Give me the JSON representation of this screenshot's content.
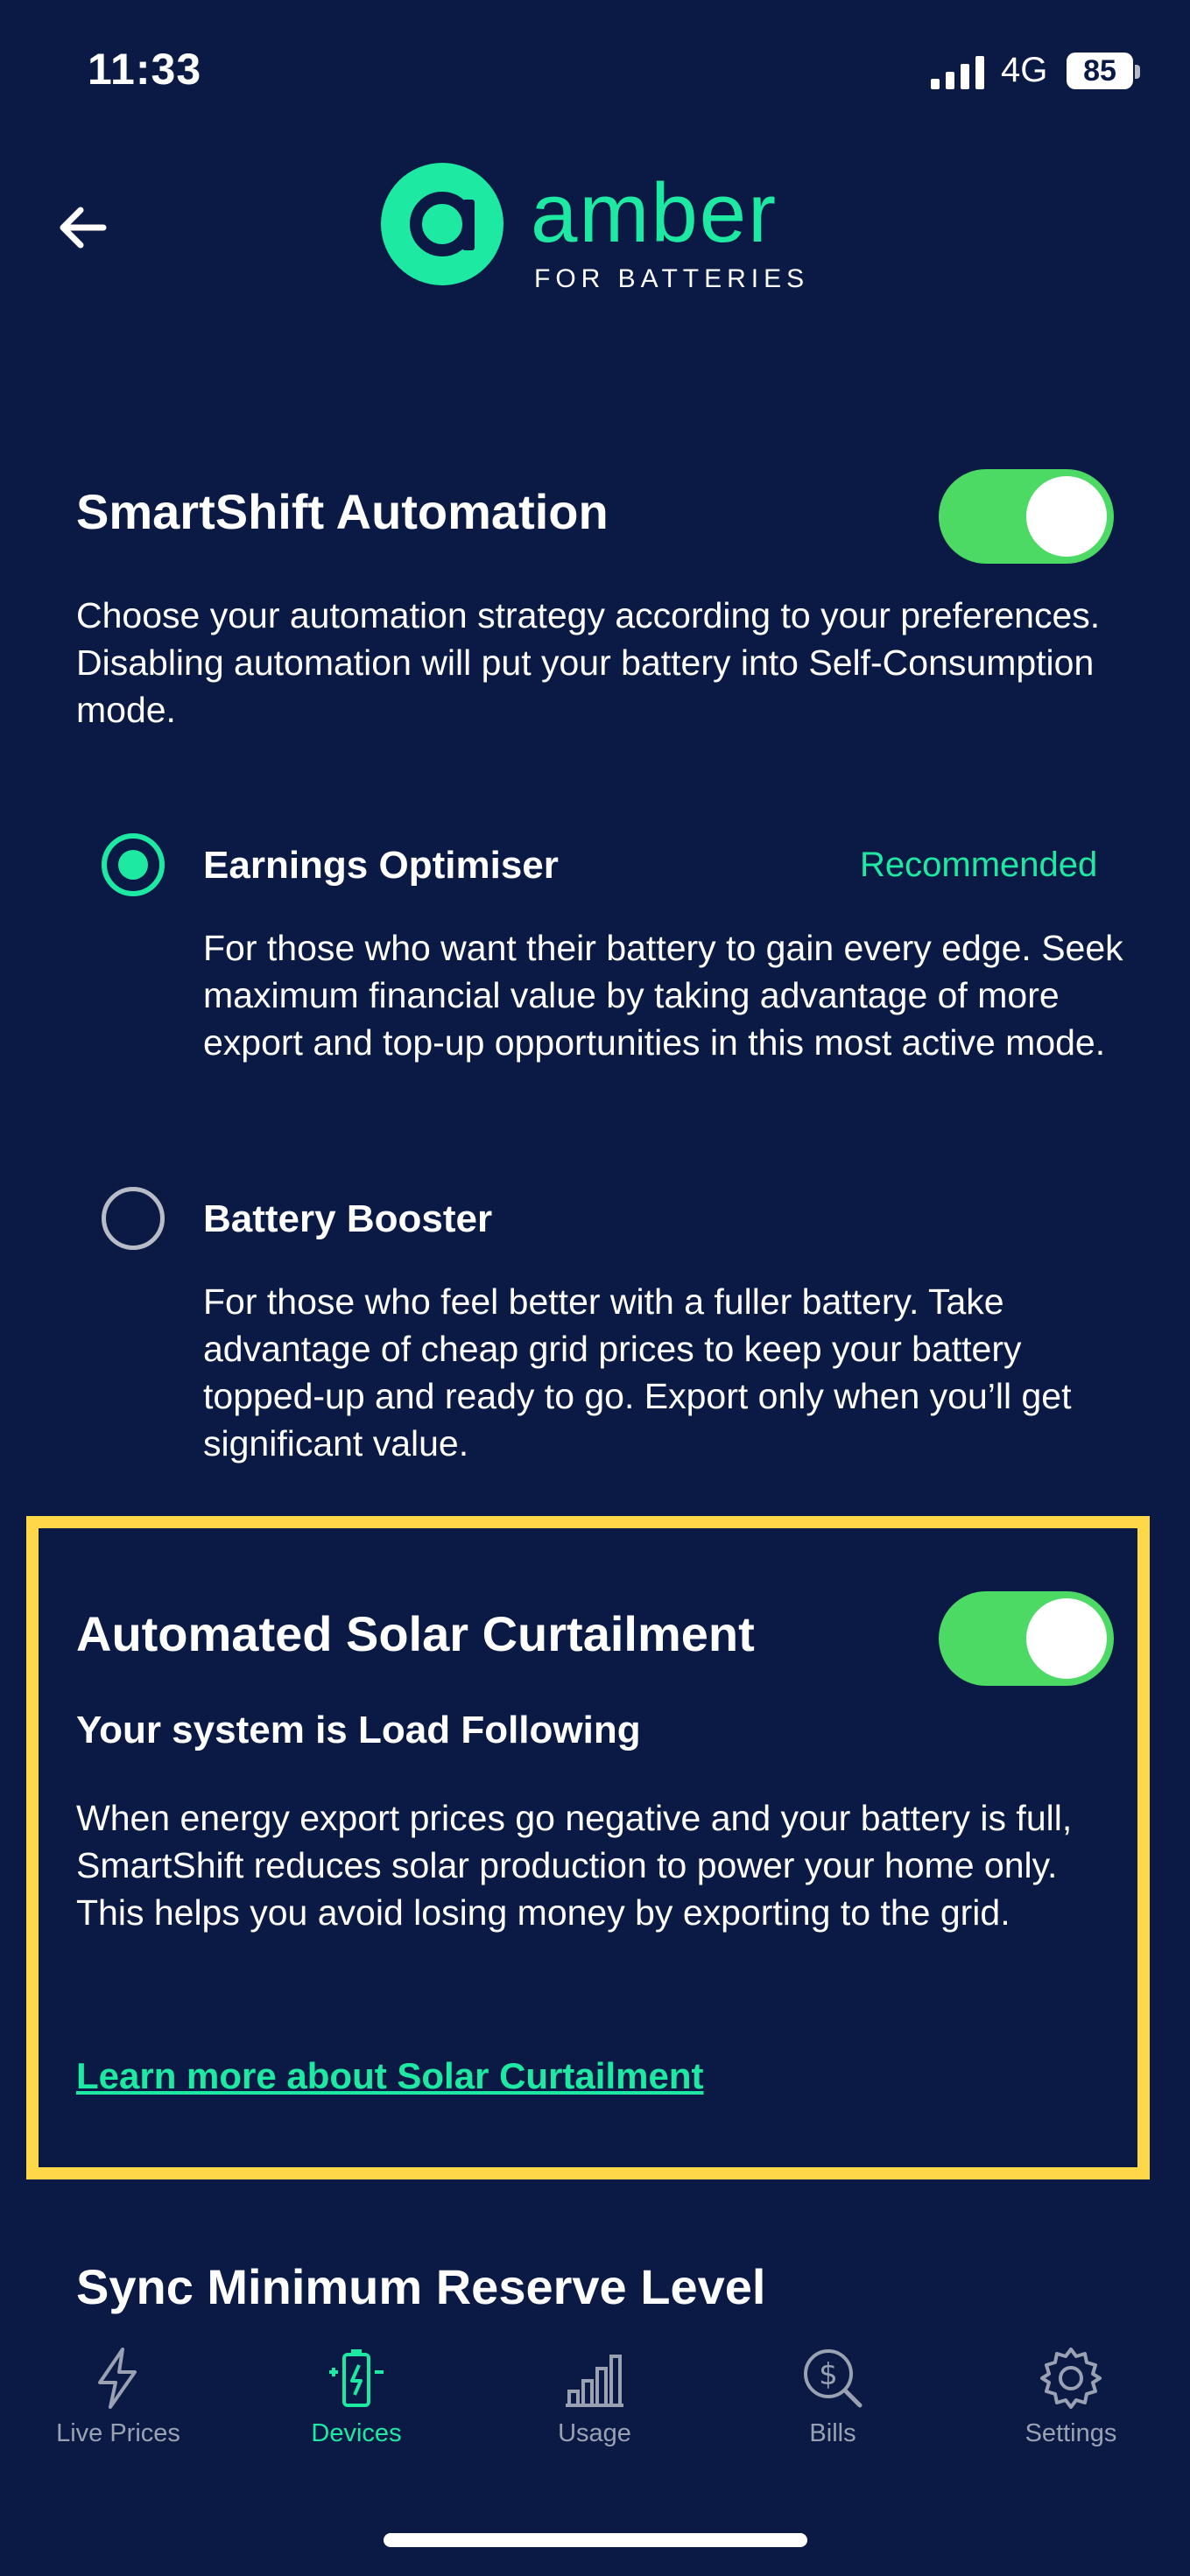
{
  "status_bar": {
    "time": "11:33",
    "network": "4G",
    "battery": "85"
  },
  "header": {
    "brand": "amber",
    "brand_sub": "FOR BATTERIES",
    "back_icon": "arrow-left-icon"
  },
  "smartshift": {
    "title": "SmartShift Automation",
    "enabled": true,
    "description": "Choose your automation strategy according to your preferences. Disabling automation will put your battery into Self-Consumption mode.",
    "options": [
      {
        "title": "Earnings Optimiser",
        "badge": "Recommended",
        "selected": true,
        "description": "For those who want their battery to gain every edge. Seek maximum financial value by taking advantage of more export and top-up opportunities in this most active mode."
      },
      {
        "title": "Battery Booster",
        "badge": "",
        "selected": false,
        "description": "For those who feel better with a fuller battery. Take advantage of cheap grid prices to keep your battery topped-up and ready to go. Export only when you’ll get significant value."
      }
    ]
  },
  "curtailment": {
    "title": "Automated Solar Curtailment",
    "enabled": true,
    "subtitle": "Your system is Load Following",
    "description": "When energy export prices go negative and your battery is full, SmartShift reduces solar production to power your home only. This helps you avoid losing money by exporting to the grid.",
    "link": "Learn more about Solar Curtailment",
    "highlight_color": "#ffd84a"
  },
  "next_section": {
    "title": "Sync Minimum Reserve Level"
  },
  "tabs": [
    {
      "label": "Live Prices",
      "icon": "lightning-icon",
      "active": false
    },
    {
      "label": "Devices",
      "icon": "battery-icon",
      "active": true
    },
    {
      "label": "Usage",
      "icon": "bar-chart-icon",
      "active": false
    },
    {
      "label": "Bills",
      "icon": "dollar-search-icon",
      "active": false
    },
    {
      "label": "Settings",
      "icon": "gear-icon",
      "active": false
    }
  ],
  "colors": {
    "background": "#0b1a45",
    "accent": "#1de9a3",
    "toggle_on": "#4cd964"
  }
}
